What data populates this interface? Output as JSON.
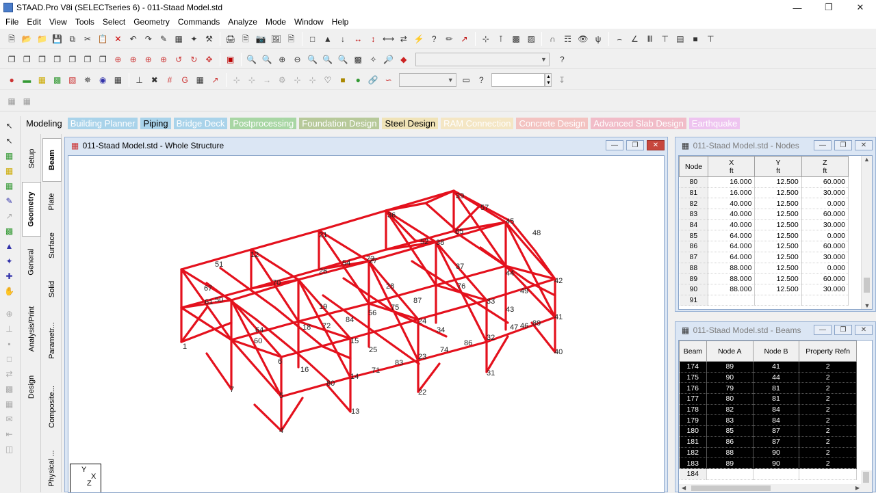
{
  "app": {
    "title": "STAAD.Pro V8i (SELECTseries 6) - 011-Staad Model.std"
  },
  "menu": [
    "File",
    "Edit",
    "View",
    "Tools",
    "Select",
    "Geometry",
    "Commands",
    "Analyze",
    "Mode",
    "Window",
    "Help"
  ],
  "page_tabs": [
    {
      "label": "Modeling",
      "color": "#000000",
      "bg": "transparent"
    },
    {
      "label": "Building Planner",
      "color": "#ffffff",
      "bg": "#a9d3ea"
    },
    {
      "label": "Piping",
      "color": "#000000",
      "bg": "#a9d3ea"
    },
    {
      "label": "Bridge Deck",
      "color": "#ffffff",
      "bg": "#a9d3ea"
    },
    {
      "label": "Postprocessing",
      "color": "#ffffff",
      "bg": "#a8d6a4"
    },
    {
      "label": "Foundation Design",
      "color": "#ffffff",
      "bg": "#b7c99a"
    },
    {
      "label": "Steel Design",
      "color": "#000000",
      "bg": "#f0e3b7"
    },
    {
      "label": "RAM Connection",
      "color": "#ffffff",
      "bg": "#f4e6c4"
    },
    {
      "label": "Concrete Design",
      "color": "#ffffff",
      "bg": "#f3c3c1"
    },
    {
      "label": "Advanced Slab Design",
      "color": "#ffffff",
      "bg": "#f1bcc8"
    },
    {
      "label": "Earthquake",
      "color": "#ffffff",
      "bg": "#eec4f0"
    }
  ],
  "side_tabs_modeling": [
    "Setup",
    "Geometry",
    "General",
    "Analysis/Print",
    "Design"
  ],
  "side_tabs_geometry": [
    "Beam",
    "Plate",
    "Surface",
    "Solid",
    "Parametr...",
    "Composite...",
    "Physical ..."
  ],
  "main_window": {
    "title": "011-Staad Model.std - Whole Structure"
  },
  "axis_triad": {
    "y": "Y",
    "x": "X",
    "z": "Z"
  },
  "node_labels": [
    "1",
    "4",
    "5",
    "6",
    "7",
    "12",
    "13",
    "14",
    "15",
    "16",
    "18",
    "19",
    "21",
    "22",
    "23",
    "24",
    "25",
    "26",
    "27",
    "28",
    "31",
    "32",
    "33",
    "34",
    "36",
    "37",
    "38",
    "39",
    "40",
    "41",
    "42",
    "43",
    "44",
    "45",
    "46",
    "47",
    "48",
    "49",
    "50",
    "51",
    "52",
    "54",
    "56",
    "57",
    "60",
    "61",
    "64",
    "65",
    "67",
    "70",
    "71",
    "72",
    "73",
    "74",
    "75",
    "76",
    "80",
    "83",
    "84",
    "86",
    "87",
    "89"
  ],
  "nodes_window": {
    "title": "011-Staad Model.std - Nodes",
    "columns": [
      {
        "name": "Node",
        "unit": ""
      },
      {
        "name": "X",
        "unit": "ft"
      },
      {
        "name": "Y",
        "unit": "ft"
      },
      {
        "name": "Z",
        "unit": "ft"
      }
    ],
    "rows": [
      [
        "80",
        "16.000",
        "12.500",
        "60.000"
      ],
      [
        "81",
        "16.000",
        "12.500",
        "30.000"
      ],
      [
        "82",
        "40.000",
        "12.500",
        "0.000"
      ],
      [
        "83",
        "40.000",
        "12.500",
        "60.000"
      ],
      [
        "84",
        "40.000",
        "12.500",
        "30.000"
      ],
      [
        "85",
        "64.000",
        "12.500",
        "0.000"
      ],
      [
        "86",
        "64.000",
        "12.500",
        "60.000"
      ],
      [
        "87",
        "64.000",
        "12.500",
        "30.000"
      ],
      [
        "88",
        "88.000",
        "12.500",
        "0.000"
      ],
      [
        "89",
        "88.000",
        "12.500",
        "60.000"
      ],
      [
        "90",
        "88.000",
        "12.500",
        "30.000"
      ],
      [
        "91",
        "",
        "",
        ""
      ]
    ]
  },
  "beams_window": {
    "title": "011-Staad Model.std - Beams",
    "columns": [
      "Beam",
      "Node A",
      "Node B",
      "Property Refn"
    ],
    "rows": [
      [
        "174",
        "89",
        "41",
        "2"
      ],
      [
        "175",
        "90",
        "44",
        "2"
      ],
      [
        "176",
        "79",
        "81",
        "2"
      ],
      [
        "177",
        "80",
        "81",
        "2"
      ],
      [
        "178",
        "82",
        "84",
        "2"
      ],
      [
        "179",
        "83",
        "84",
        "2"
      ],
      [
        "180",
        "85",
        "87",
        "2"
      ],
      [
        "181",
        "86",
        "87",
        "2"
      ],
      [
        "182",
        "88",
        "90",
        "2"
      ],
      [
        "183",
        "89",
        "90",
        "2"
      ],
      [
        "184",
        "",
        "",
        ""
      ]
    ]
  }
}
